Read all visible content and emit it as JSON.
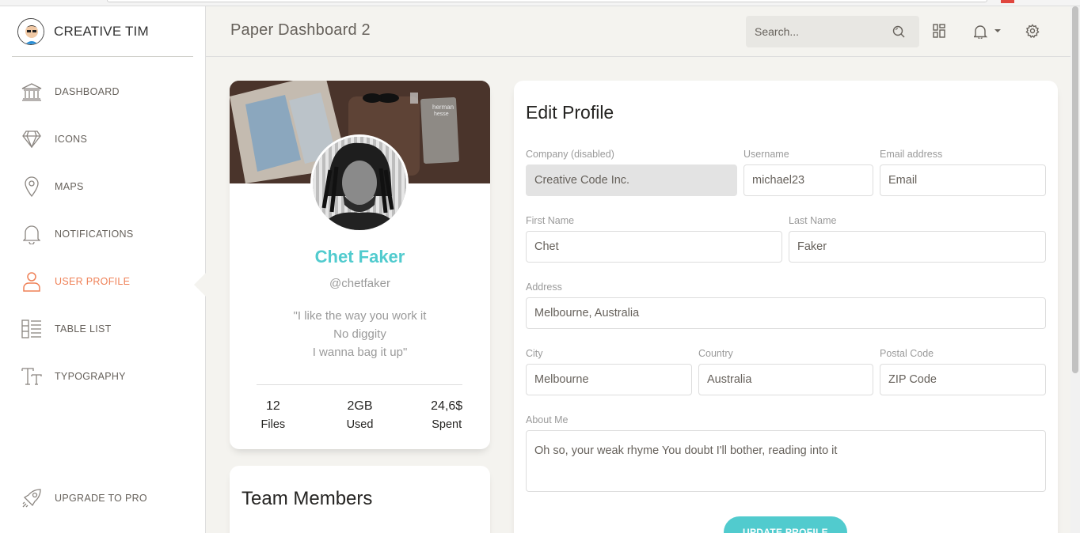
{
  "brand": {
    "name": "CREATIVE TIM"
  },
  "sidebar": {
    "items": [
      {
        "label": "DASHBOARD",
        "icon": "bank-icon"
      },
      {
        "label": "ICONS",
        "icon": "diamond-icon"
      },
      {
        "label": "MAPS",
        "icon": "map-pin-icon"
      },
      {
        "label": "NOTIFICATIONS",
        "icon": "bell-icon"
      },
      {
        "label": "USER PROFILE",
        "icon": "user-icon",
        "active": true
      },
      {
        "label": "TABLE LIST",
        "icon": "list-icon"
      },
      {
        "label": "TYPOGRAPHY",
        "icon": "text-icon"
      }
    ],
    "upgrade": {
      "label": "UPGRADE TO PRO",
      "icon": "rocket-icon"
    }
  },
  "header": {
    "title": "Paper Dashboard 2",
    "search_placeholder": "Search..."
  },
  "profile": {
    "name": "Chet Faker",
    "username": "@chetfaker",
    "quote": [
      "\"I like the way you work it",
      "No diggity",
      "I wanna bag it up\""
    ],
    "stats": [
      {
        "value": "12",
        "label": "Files"
      },
      {
        "value": "2GB",
        "label": "Used"
      },
      {
        "value": "24,6$",
        "label": "Spent"
      }
    ]
  },
  "team": {
    "title": "Team Members"
  },
  "edit_profile": {
    "title": "Edit Profile",
    "company": {
      "label": "Company (disabled)",
      "value": "Creative Code Inc."
    },
    "username": {
      "label": "Username",
      "value": "michael23"
    },
    "email": {
      "label": "Email address",
      "placeholder": "Email"
    },
    "first_name": {
      "label": "First Name",
      "value": "Chet"
    },
    "last_name": {
      "label": "Last Name",
      "value": "Faker"
    },
    "address": {
      "label": "Address",
      "value": "Melbourne, Australia"
    },
    "city": {
      "label": "City",
      "value": "Melbourne"
    },
    "country": {
      "label": "Country",
      "value": "Australia"
    },
    "postal": {
      "label": "Postal Code",
      "placeholder": "ZIP Code"
    },
    "about": {
      "label": "About Me",
      "value": "Oh so, your weak rhyme You doubt I'll bother, reading into it"
    },
    "submit_label": "UPDATE PROFILE"
  },
  "colors": {
    "accent": "#51cbce",
    "active": "#ef8157",
    "background": "#f4f3ef"
  }
}
